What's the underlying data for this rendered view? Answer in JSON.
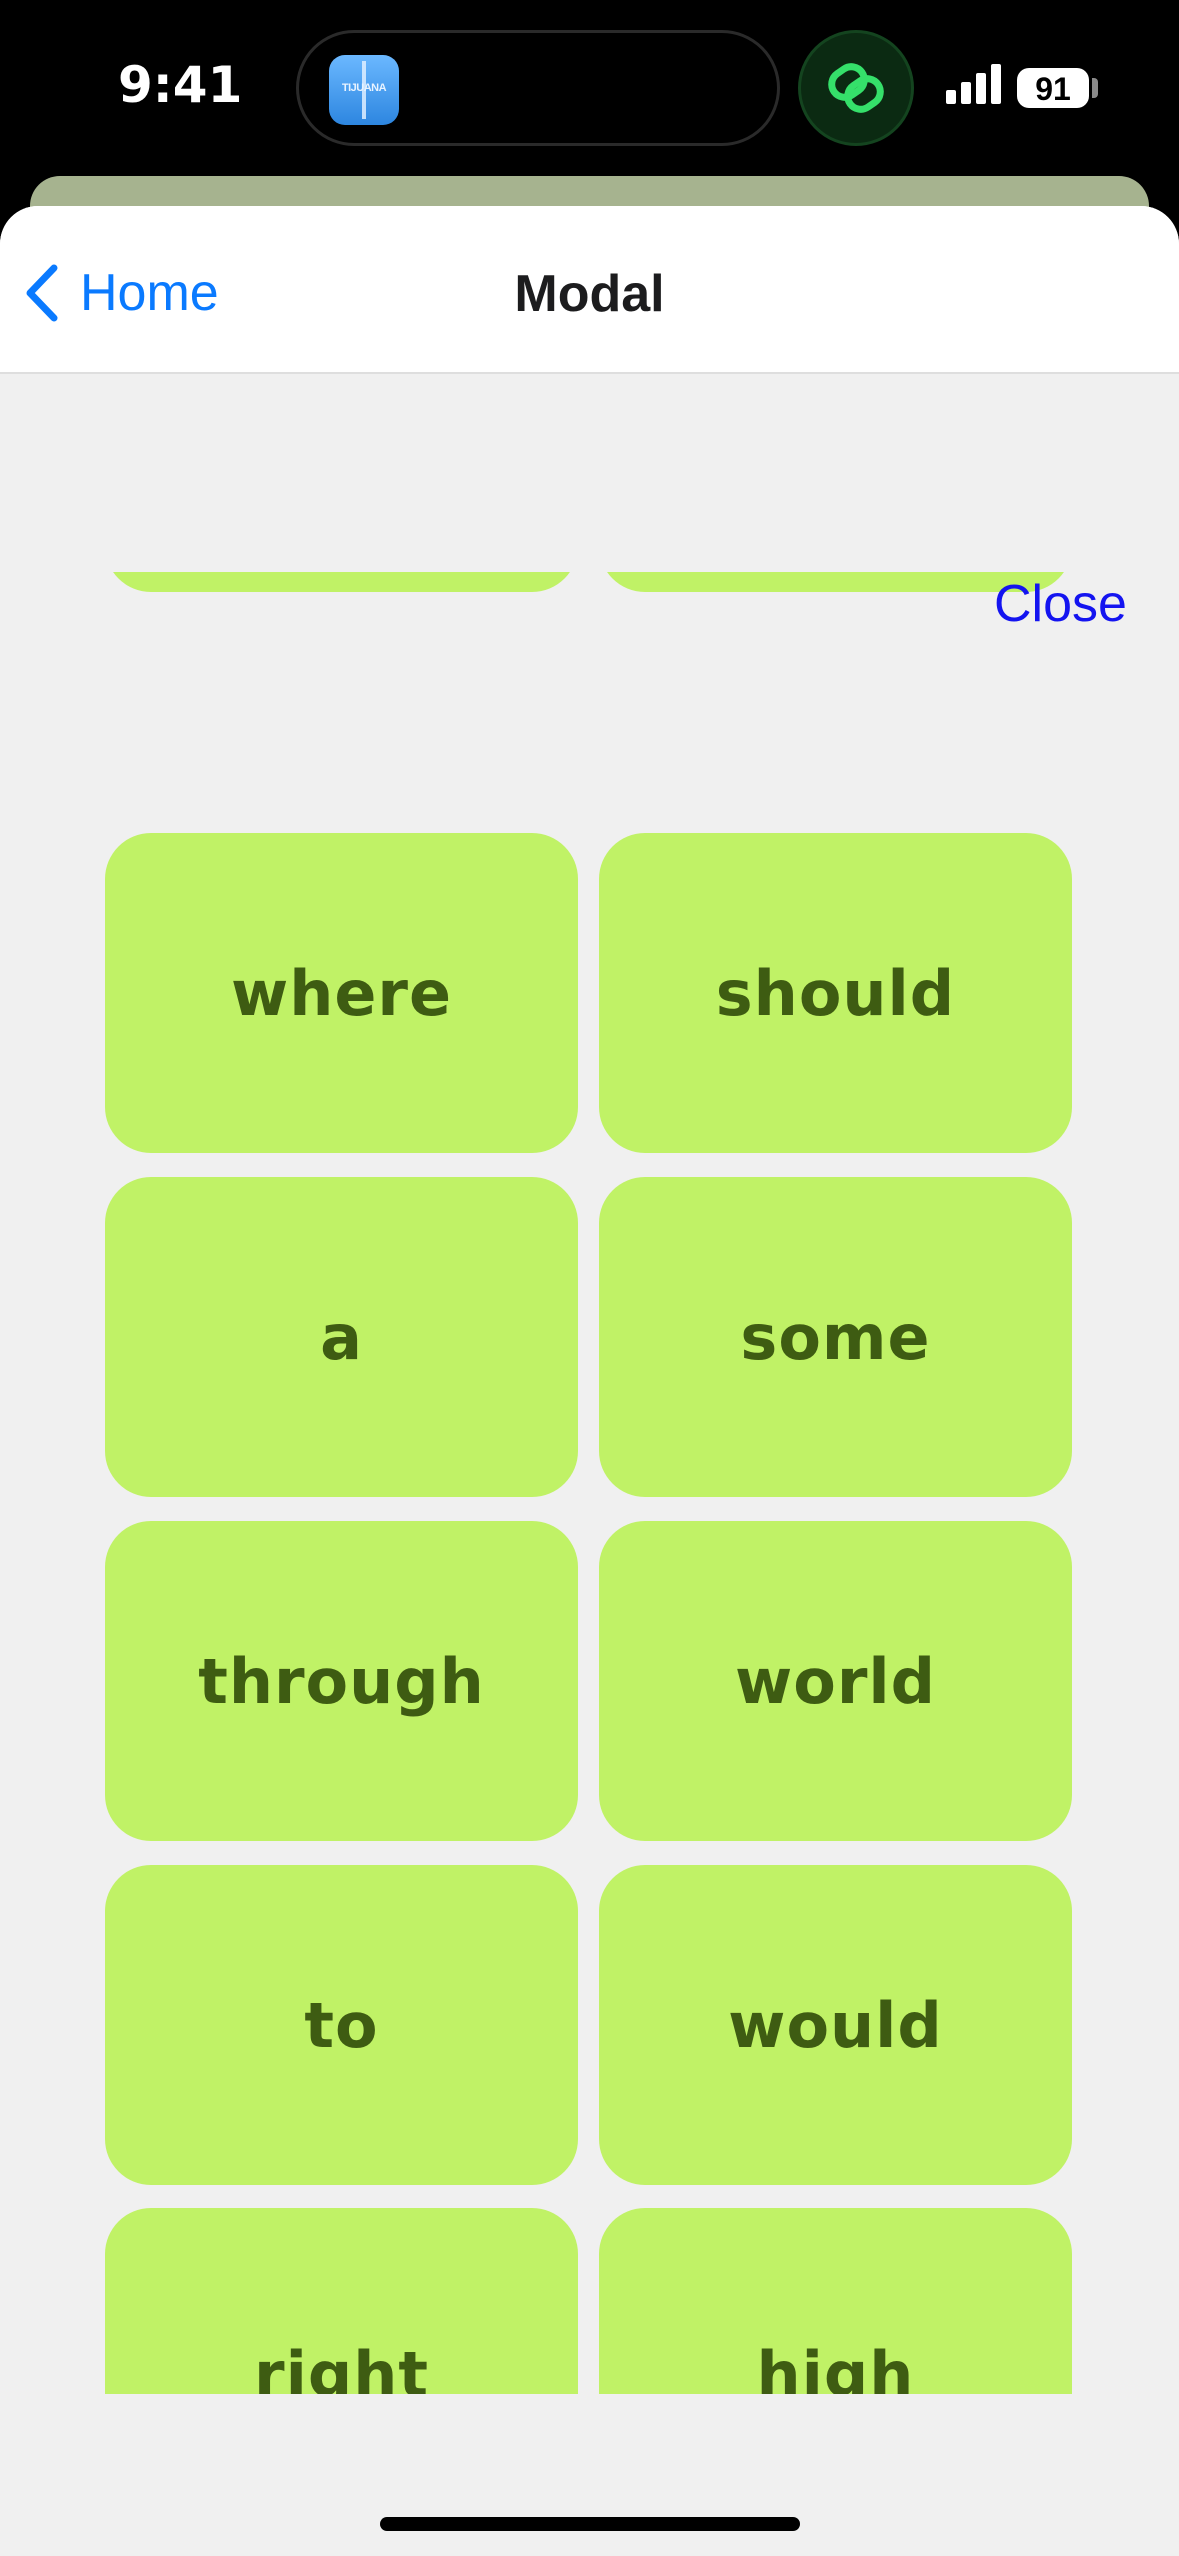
{
  "status_bar": {
    "time": "9:41",
    "app_icon_text": "TIJUANA",
    "battery": "91"
  },
  "navbar": {
    "back_label": "Home",
    "title": "Modal"
  },
  "close_label": "Close",
  "cards": [
    "where",
    "should",
    "a",
    "some",
    "through",
    "world",
    "to",
    "would",
    "right",
    "high"
  ],
  "colors": {
    "card_bg": "#c0f266",
    "card_text": "#3e5c12",
    "link_blue": "#0a7aff",
    "close_blue": "#1414f0"
  }
}
